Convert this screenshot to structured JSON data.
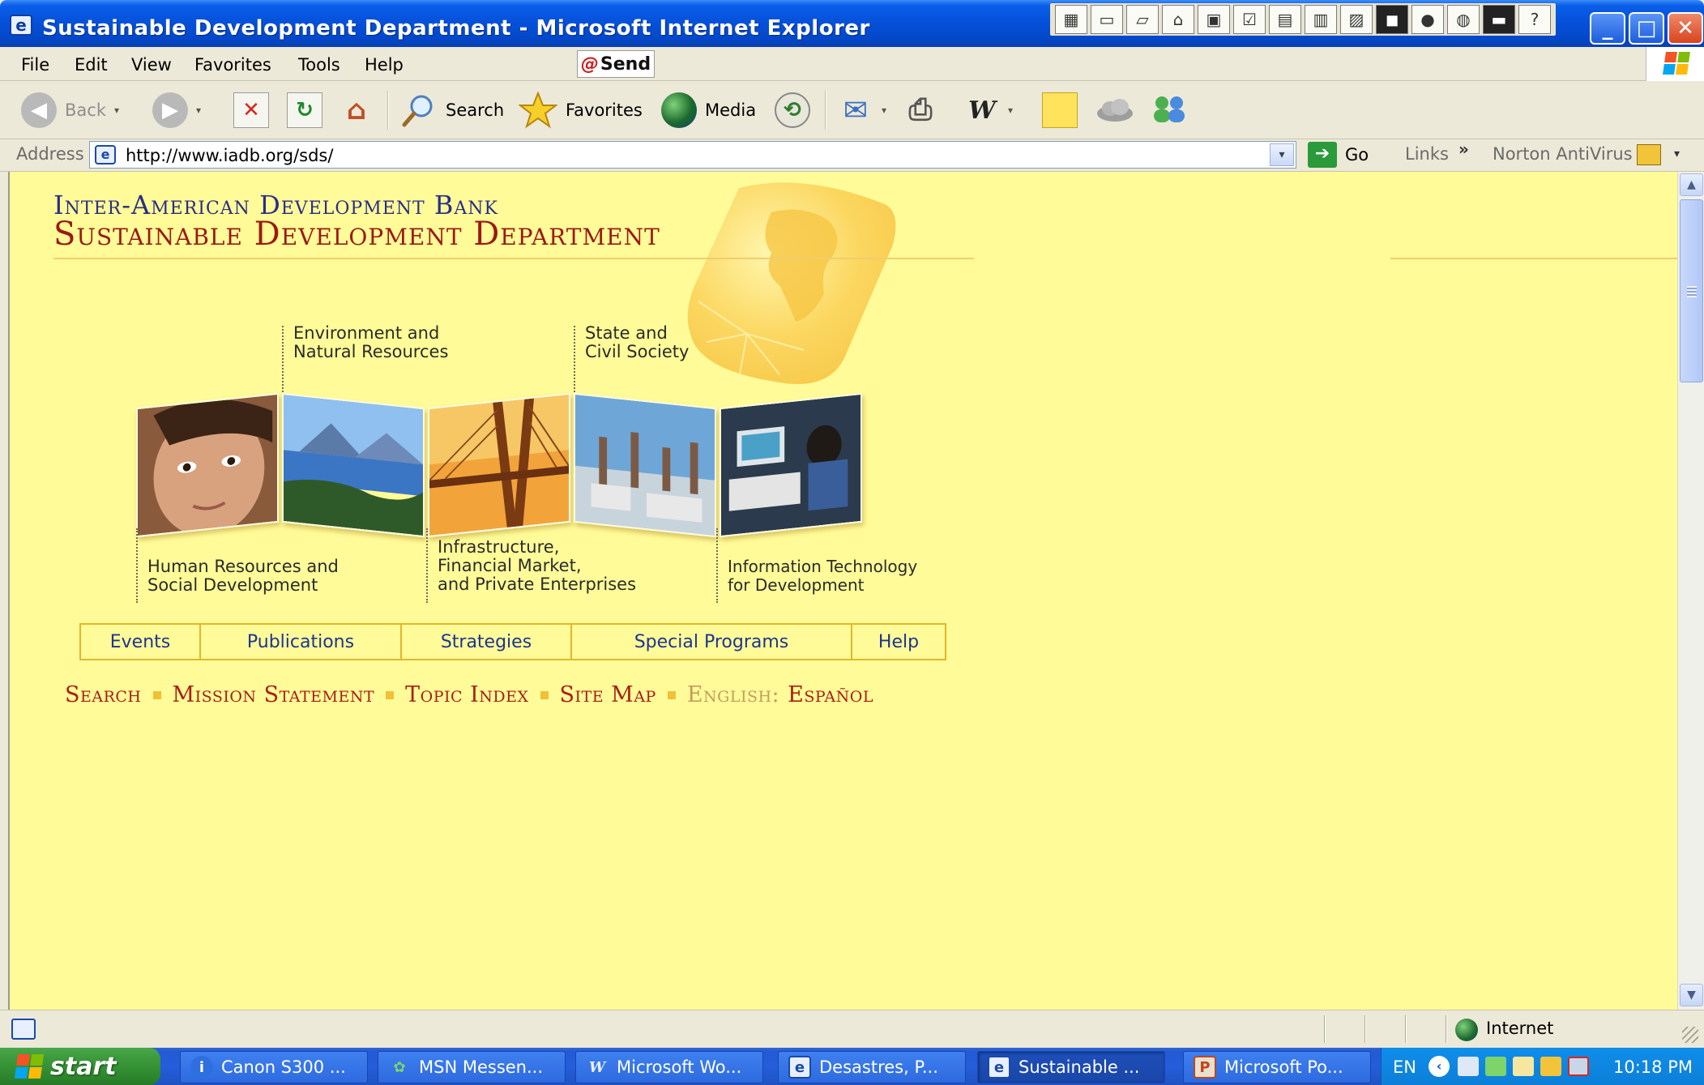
{
  "window": {
    "title": "Sustainable Development Department - Microsoft Internet Explorer",
    "title_icon": "e",
    "minimize_label": "_",
    "maximize_label": "□",
    "close_label": "✕",
    "title_tray_icons": [
      "windows-flag-icon",
      "notepad-icon",
      "open-folder-icon",
      "network-icon",
      "window-icon",
      "checklist-icon",
      "card-icon",
      "document-icon",
      "note-icon",
      "black-panel-icon",
      "opera-icon",
      "ie-icon",
      "console-icon",
      "help-icon"
    ]
  },
  "menubar": {
    "items": [
      "File",
      "Edit",
      "View",
      "Favorites",
      "Tools",
      "Help"
    ],
    "send_logo": "@",
    "send_label": "Send"
  },
  "toolbar": {
    "back_label": "Back",
    "back_icon": "◀",
    "forward_icon": "▶",
    "stop_icon": "✕",
    "refresh_icon": "↻",
    "home_icon": "⌂",
    "search_label": "Search",
    "favorites_label": "Favorites",
    "media_label": "Media",
    "history_icon": "⟲",
    "mail_icon": "✉",
    "print_icon": "⎙",
    "word_icon": "W",
    "dropdown_glyph": "▾"
  },
  "address": {
    "label": "Address",
    "icon": "e",
    "url": "http://www.iadb.org/sds/",
    "dropdown_glyph": "▾",
    "go_label": "Go",
    "go_icon": "➔",
    "links_label": "Links",
    "links_chevron": "»",
    "norton_label": "Norton AntiVirus",
    "norton_dropdown": "▾"
  },
  "page": {
    "org_name": "Inter-American Development Bank",
    "dept_name": "Sustainable Development Department",
    "sectors": {
      "environment": [
        "Environment and",
        "Natural Resources"
      ],
      "state": [
        "State and",
        "Civil Society"
      ],
      "human": [
        "Human Resources and",
        "Social Development"
      ],
      "infrastructure": [
        "Infrastructure,",
        "Financial Market,",
        "and Private Enterprises"
      ],
      "it": [
        "Information Technology",
        "for Development"
      ]
    },
    "nav": [
      "Events",
      "Publications",
      "Strategies",
      "Special Programs",
      "Help"
    ],
    "links": {
      "search": "Search",
      "mission": "Mission Statement",
      "topic": "Topic Index",
      "sitemap": "Site Map",
      "english": "English:",
      "espanol": "Español"
    },
    "colors": {
      "background": "#fffb98",
      "accent_red": "#a81f14",
      "accent_blue": "#1d3590",
      "accent_gold": "#e4b52a"
    }
  },
  "scrollbar": {
    "up_glyph": "▲",
    "down_glyph": "▼"
  },
  "statusbar": {
    "zone": "Internet"
  },
  "taskbar": {
    "start_label": "start",
    "tasks": [
      {
        "label": "Canon S300 ...",
        "icon": "i"
      },
      {
        "label": "MSN Messen...",
        "icon": "✿"
      },
      {
        "label": "Microsoft Wo...",
        "icon": "W"
      },
      {
        "label": "Desastres, P...",
        "icon": "e"
      },
      {
        "label": "Sustainable ...",
        "icon": "e"
      },
      {
        "label": "Microsoft Po...",
        "icon": "P"
      }
    ],
    "lang": "EN",
    "tray_chevron": "‹",
    "clock": "10:18 PM"
  }
}
